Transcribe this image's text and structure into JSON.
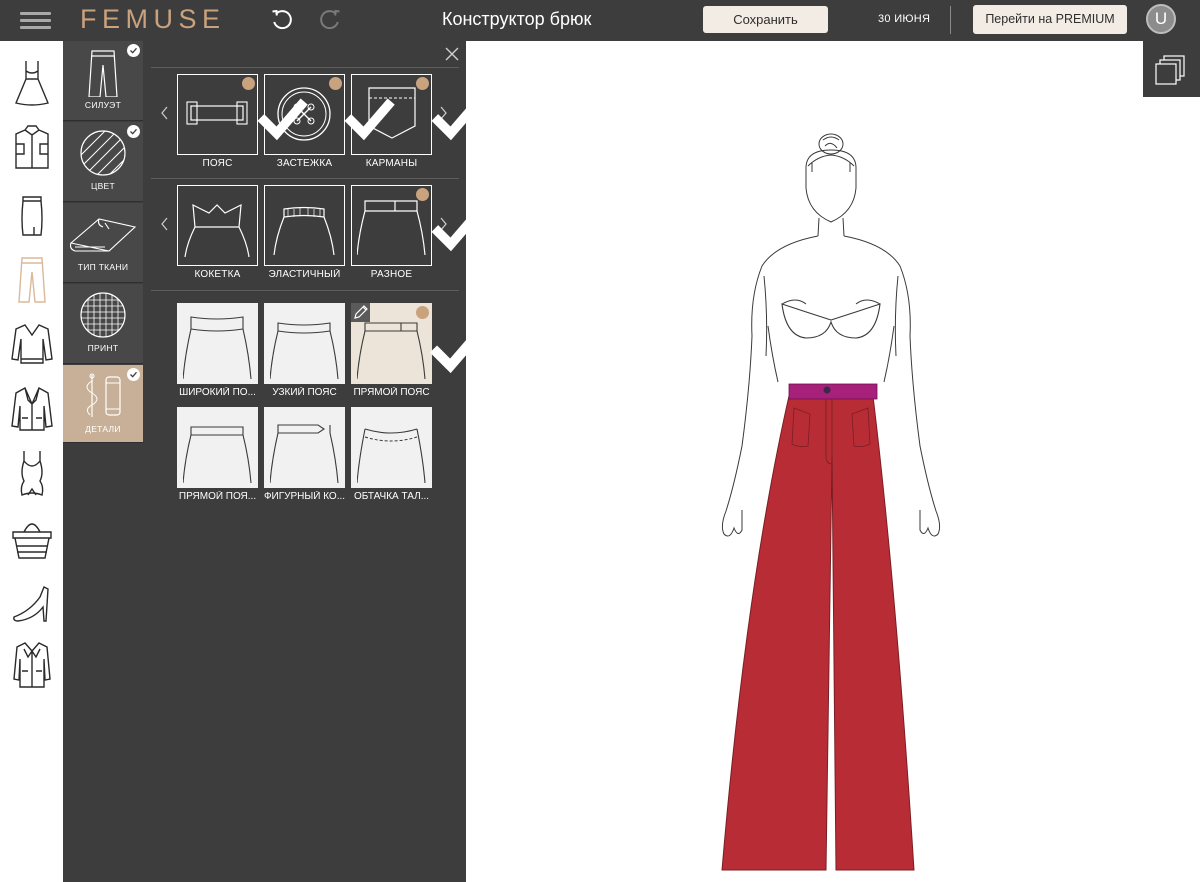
{
  "header": {
    "logo": "FEMUSE",
    "title": "Конструктор брюк",
    "save_label": "Сохранить",
    "date": "30 ИЮНЯ",
    "premium_label": "Перейти на PREMIUM",
    "avatar_letter": "U"
  },
  "categories": [
    {
      "name": "dress"
    },
    {
      "name": "shirt"
    },
    {
      "name": "skirt"
    },
    {
      "name": "trousers",
      "active": true
    },
    {
      "name": "sweater"
    },
    {
      "name": "jacket"
    },
    {
      "name": "swimsuit"
    },
    {
      "name": "bag"
    },
    {
      "name": "shoe"
    },
    {
      "name": "coat"
    }
  ],
  "subtabs": [
    {
      "label": "СИЛУЭТ",
      "checked": true
    },
    {
      "label": "ЦВЕТ",
      "checked": true
    },
    {
      "label": "ТИП ТКАНИ",
      "checked": false
    },
    {
      "label": "ПРИНТ",
      "checked": false
    },
    {
      "label": "ДЕТАЛИ",
      "checked": true,
      "active": true
    }
  ],
  "detail_groups": {
    "row1": [
      {
        "label": "ПОЯС",
        "checked": true
      },
      {
        "label": "ЗАСТЕЖКА",
        "checked": true
      },
      {
        "label": "КАРМАНЫ",
        "checked": true
      }
    ],
    "row2": [
      {
        "label": "КОКЕТКА",
        "checked": false
      },
      {
        "label": "ЭЛАСТИЧНЫЙ",
        "checked": false
      },
      {
        "label": "РАЗНОЕ",
        "checked": true
      }
    ]
  },
  "options": [
    {
      "label": "ШИРОКИЙ ПО...",
      "selected": false
    },
    {
      "label": "УЗКИЙ ПОЯС",
      "selected": false
    },
    {
      "label": "ПРЯМОЙ ПОЯС",
      "selected": true
    },
    {
      "label": "ПРЯМОЙ ПОЯ...",
      "selected": false
    },
    {
      "label": "ФИГУРНЫЙ КО...",
      "selected": false
    },
    {
      "label": "ОБТАЧКА ТАЛ...",
      "selected": false
    }
  ],
  "colors": {
    "topbar": "#3d3d3d",
    "accent_gold": "#c9a27e",
    "trousers": "#b82d35",
    "waistband": "#a7207a",
    "selected_tile": "#ece4d8"
  }
}
